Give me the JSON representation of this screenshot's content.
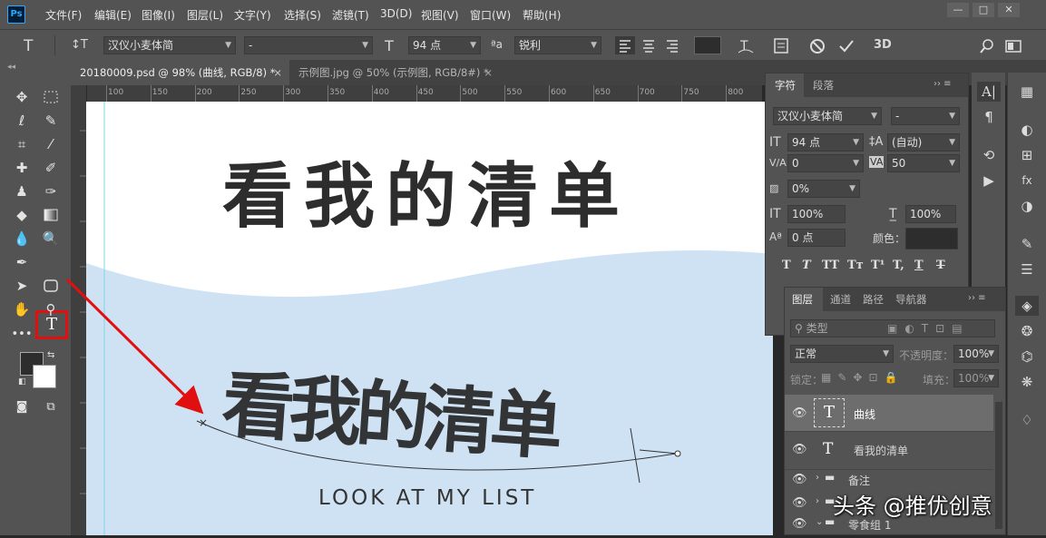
{
  "app": {
    "logo": "Ps"
  },
  "menu": [
    "文件(F)",
    "编辑(E)",
    "图像(I)",
    "图层(L)",
    "文字(Y)",
    "选择(S)",
    "滤镜(T)",
    "3D(D)",
    "视图(V)",
    "窗口(W)",
    "帮助(H)"
  ],
  "window_controls": [
    "—",
    "□",
    "✕"
  ],
  "options": {
    "tool_icon": "T",
    "orient_icon": "↕T",
    "font_family": "汉仪小麦体简",
    "font_style": "-",
    "size_icon": "T",
    "font_size": "94 点",
    "aa_icon": "ªa",
    "anti_alias": "锐利",
    "btn_3d": "3D"
  },
  "tabs": [
    {
      "label": "20180009.psd @ 98% (曲线, RGB/8) *",
      "close": "×"
    },
    {
      "label": "示例图.jpg @ 50% (示例图, RGB/8#) *",
      "close": "×"
    }
  ],
  "ruler": {
    "ticks": [
      "100",
      "150",
      "200",
      "250",
      "300",
      "350",
      "400",
      "450",
      "500",
      "550",
      "600",
      "650",
      "700",
      "750",
      "800",
      "850"
    ]
  },
  "canvas": {
    "title_text": "看我的清单",
    "curve_text": "看我的清单",
    "subtitle": "LOOK AT MY LIST",
    "wave_color": "#cfe2f4"
  },
  "character_panel": {
    "tabs": [
      "字符",
      "段落"
    ],
    "font_family": "汉仪小麦体简",
    "font_style": "-",
    "size": "94 点",
    "leading": "(自动)",
    "kerning": "0",
    "tracking": "50",
    "tsume": "0%",
    "vscale": "100%",
    "hscale": "100%",
    "baseline": "0 点",
    "color_label": "颜色：",
    "style_buttons": [
      "T",
      "T",
      "TT",
      "Tт",
      "T¹",
      "T,",
      "T",
      "T"
    ]
  },
  "layers_panel": {
    "tabs": [
      "图层",
      "通道",
      "路径",
      "导航器"
    ],
    "filter_label": "类型",
    "blend_mode": "正常",
    "opacity_label": "不透明度：",
    "opacity": "100%",
    "lock_label": "锁定：",
    "fill_label": "填充：",
    "fill": "100%",
    "layers": [
      {
        "type": "T",
        "name": "曲线"
      },
      {
        "type": "T",
        "name": "看我的清单"
      },
      {
        "type": "folder",
        "name": "备注"
      },
      {
        "type": "folder",
        "name": ""
      },
      {
        "type": "folder",
        "name": "零食组 1"
      }
    ]
  },
  "watermark": "头条 @推优创意"
}
